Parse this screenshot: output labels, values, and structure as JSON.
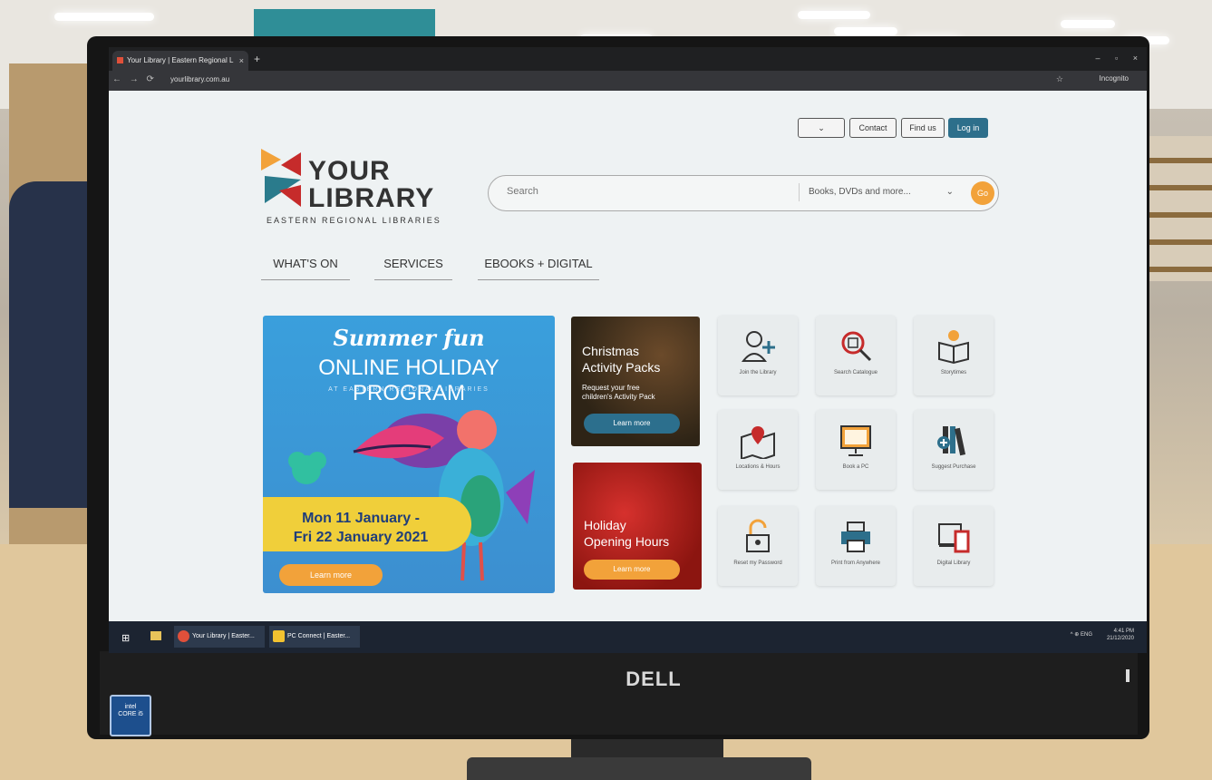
{
  "browser": {
    "tab_title": "Your Library | Eastern Regional L",
    "tab_close": "×",
    "new_tab": "+",
    "url": "yourlibrary.com.au",
    "profile": "Incognito",
    "window_controls": "– ▫ ×"
  },
  "header": {
    "lang_label": "",
    "contact_label": "Contact",
    "findus_label": "Find us",
    "login_label": "Log in"
  },
  "logo": {
    "line1": "YOUR",
    "line2": "LIBRARY",
    "tagline": "EASTERN REGIONAL LIBRARIES"
  },
  "search": {
    "placeholder": "Search",
    "scope": "Books, DVDs and more...",
    "go_label": "Go"
  },
  "nav": {
    "items": [
      {
        "label": "WHAT'S ON"
      },
      {
        "label": "SERVICES"
      },
      {
        "label": "EBOOKS + DIGITAL"
      }
    ]
  },
  "banners": {
    "main": {
      "title1": "Summer fun",
      "title2": "ONLINE HOLIDAY PROGRAM",
      "subtitle": "AT EASTERN REGIONAL LIBRARIES",
      "dates_line1": "Mon 11 January -",
      "dates_line2": "Fri 22 January 2021",
      "button": "Learn more"
    },
    "christmas": {
      "title_line1": "Christmas",
      "title_line2": "Activity Packs",
      "sub_line1": "Request your free",
      "sub_line2": "children's Activity Pack",
      "button": "Learn more"
    },
    "holiday": {
      "title_line1": "Holiday",
      "title_line2": "Opening Hours",
      "button": "Learn more"
    }
  },
  "tiles": [
    {
      "label": "Join the Library",
      "icon": "add-user-icon"
    },
    {
      "label": "Search Catalogue",
      "icon": "search-catalogue-icon"
    },
    {
      "label": "Storytimes",
      "icon": "book-reader-icon"
    },
    {
      "label": "Locations & Hours",
      "icon": "map-pin-icon"
    },
    {
      "label": "Book a PC",
      "icon": "monitor-icon"
    },
    {
      "label": "Suggest Purchase",
      "icon": "books-plus-icon"
    },
    {
      "label": "Reset my Password",
      "icon": "unlock-icon"
    },
    {
      "label": "Print from Anywhere",
      "icon": "printer-icon"
    },
    {
      "label": "Digital Library",
      "icon": "devices-icon"
    }
  ],
  "taskbar": {
    "item1": "Your Library | Easter...",
    "item2": "PC Connect | Easter...",
    "lang": "ENG",
    "time": "4:41 PM",
    "date": "21/12/2020"
  },
  "monitor": {
    "brand": "DELL",
    "sticker_line1": "intel",
    "sticker_line2": "CORE i5"
  },
  "colors": {
    "accent_teal": "#2d6f8b",
    "accent_orange": "#f2a23a",
    "brand_red": "#c62b2b"
  }
}
